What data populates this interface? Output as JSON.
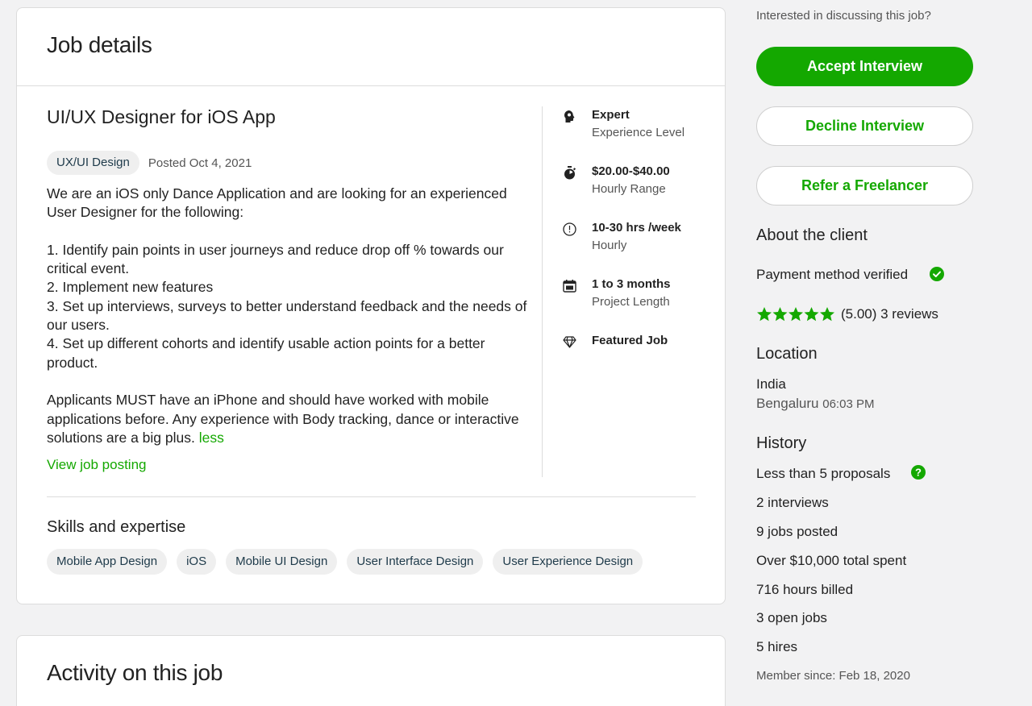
{
  "job_card": {
    "header_title": "Job details",
    "job_title": "UI/UX Designer for iOS App",
    "category_pill": "UX/UI Design",
    "posted": "Posted Oct 4, 2021",
    "description": "We are an iOS only Dance Application and are looking for an experienced User Designer for the following:\n\n1. Identify pain points in user journeys and reduce drop off % towards our critical event.\n2. Implement new features\n3. Set up interviews, surveys to better understand feedback and the needs of our users.\n4. Set up different cohorts and identify usable action points for a better product.\n\nApplicants MUST have an iPhone and should have worked with mobile applications before. Any experience with Body tracking, dance or interactive solutions are a big plus. ",
    "less_link": "less",
    "view_posting": "View job posting",
    "details": [
      {
        "icon": "brain-icon",
        "strong": "Expert",
        "sub": "Experience Level"
      },
      {
        "icon": "stopwatch-icon",
        "strong": "$20.00-$40.00",
        "sub": "Hourly Range"
      },
      {
        "icon": "clock-icon",
        "strong": "10-30 hrs /week",
        "sub": "Hourly"
      },
      {
        "icon": "calendar-icon",
        "strong": "1 to 3 months",
        "sub": "Project Length"
      },
      {
        "icon": "diamond-icon",
        "strong": "Featured Job",
        "sub": ""
      }
    ],
    "skills_title": "Skills and expertise",
    "skills": [
      "Mobile App Design",
      "iOS",
      "Mobile UI Design",
      "User Interface Design",
      "User Experience Design"
    ]
  },
  "activity": {
    "title": "Activity on this job"
  },
  "sidebar": {
    "interest_text": "Interested in discussing this job?",
    "accept_label": "Accept Interview",
    "decline_label": "Decline Interview",
    "refer_label": "Refer a Freelancer",
    "about_title": "About the client",
    "payment_verified": "Payment method verified",
    "rating": 5.0,
    "rating_text": "(5.00) 3 reviews",
    "location_title": "Location",
    "country": "India",
    "city": "Bengaluru",
    "local_time": "06:03 PM",
    "history_title": "History",
    "proposals": "Less than 5 proposals",
    "interviews": "2 interviews",
    "jobs_posted": "9 jobs posted",
    "total_spent": "Over $10,000 total spent",
    "hours_billed": "716 hours billed",
    "open_jobs": "3 open jobs",
    "hires": "5 hires",
    "member_since": "Member since: Feb 18, 2020"
  },
  "colors": {
    "accent": "#14a800",
    "background": "#f2f2f3"
  }
}
